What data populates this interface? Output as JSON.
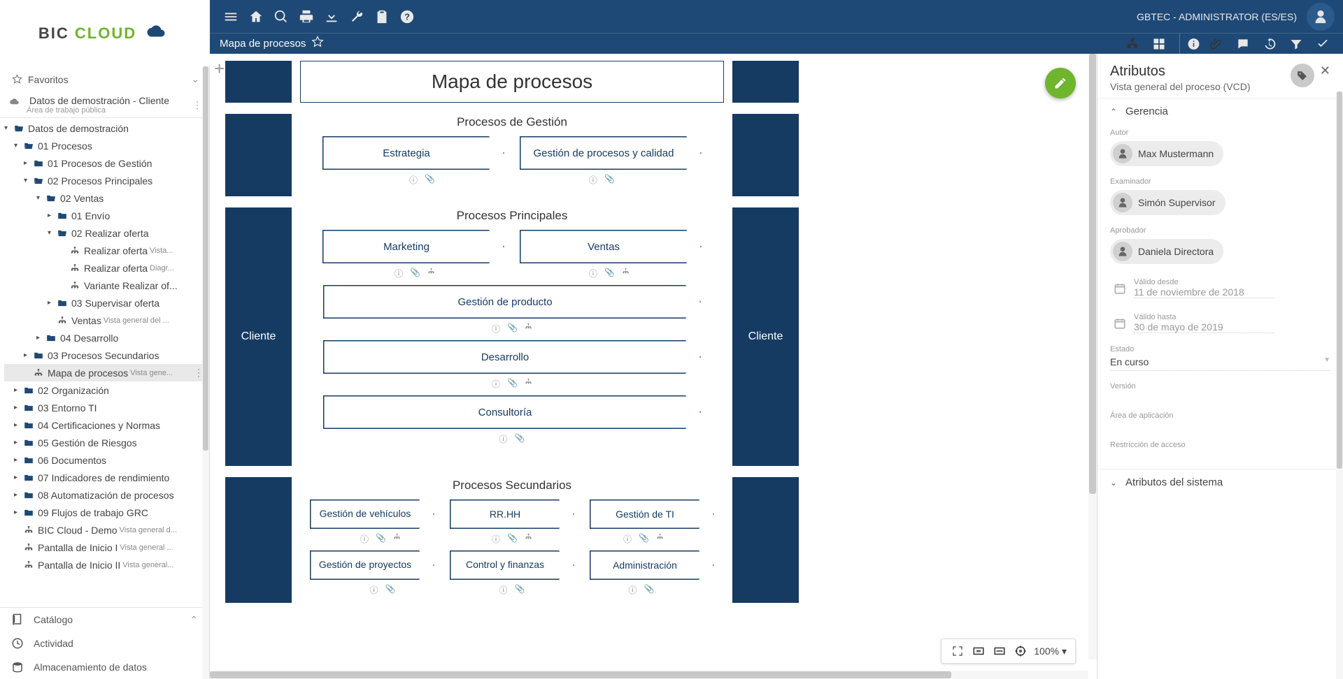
{
  "header": {
    "user_text": "GBTEC - ADMINISTRATOR (ES/ES)",
    "breadcrumb": "Mapa de procesos"
  },
  "logo": {
    "brand1": "BIC",
    "brand2": "CLOUD"
  },
  "sidebar": {
    "favorites": "Favoritos",
    "workspace_title": "Datos de demostración - Cliente",
    "workspace_sub": "Área de trabajo pública",
    "catalogo": "Catálogo",
    "bottom": {
      "actividad": "Actividad",
      "almacenamiento": "Almacenamiento de datos"
    },
    "tree": {
      "root": "Datos de demostración",
      "n01": "01 Procesos",
      "n01a": "01 Procesos de Gestión",
      "n01b": "02 Procesos Principales",
      "n01b2": "02 Ventas",
      "n01b2a": "01 Envío",
      "n01b2b": "02 Realizar oferta",
      "d1": "Realizar oferta",
      "d1s": "Vista...",
      "d2": "Realizar oferta",
      "d2s": "Diagr...",
      "d3": "Variante Realizar of...",
      "n01b2c": "03 Supervisar oferta",
      "dv": "Ventas",
      "dvs": "Vista general del ...",
      "n01b4": "04 Desarrollo",
      "n01c": "03 Procesos Secundarios",
      "map": "Mapa de procesos",
      "maps": "Vista gene...",
      "n02": "02 Organización",
      "n03": "03 Entorno TI",
      "n04": "04 Certificaciones y Normas",
      "n05": "05 Gestión de Riesgos",
      "n06": "06 Documentos",
      "n07": "07 Indicadores de rendimiento",
      "n08": "08 Automatización de procesos",
      "n09": "09 Flujos de trabajo GRC",
      "demo": "BIC Cloud - Demo",
      "demos": "Vista general d...",
      "p1": "Pantalla de Inicio I",
      "p1s": "Vista general ...",
      "p2": "Pantalla de Inicio II",
      "p2s": "Vista general..."
    }
  },
  "diagram": {
    "title": "Mapa de procesos",
    "cliente": "Cliente",
    "gestion_head": "Procesos de Gestión",
    "estrategia": "Estrategia",
    "gpc": "Gestión de procesos y calidad",
    "principales_head": "Procesos Principales",
    "marketing": "Marketing",
    "ventas": "Ventas",
    "gprod": "Gestión de producto",
    "desarrollo": "Desarrollo",
    "consultoria": "Consultoría",
    "secundarios_head": "Procesos Secundarios",
    "gveh": "Gestión de vehículos",
    "rrhh": "RR.HH",
    "gti": "Gestión de TI",
    "gproy": "Gestión de proyectos",
    "cfin": "Control y finanzas",
    "admin": "Administración"
  },
  "zoom": {
    "level": "100%"
  },
  "panel": {
    "title": "Atributos",
    "subtitle": "Vista general del proceso (VCD)",
    "sec_gerencia": "Gerencia",
    "autor_label": "Autor",
    "autor": "Max Mustermann",
    "examinador_label": "Examinador",
    "examinador": "Simón Supervisor",
    "aprobador_label": "Aprobador",
    "aprobador": "Daniela Directora",
    "valido_desde_label": "Válido desde",
    "valido_desde": "11 de noviembre de 2018",
    "valido_hasta_label": "Válido hasta",
    "valido_hasta": "30 de mayo de 2019",
    "estado_label": "Estado",
    "estado": "En curso",
    "version_label": "Versión",
    "area_label": "Área de aplicación",
    "restriccion_label": "Restricción de acceso",
    "sec_sistema": "Atributos del sistema"
  }
}
